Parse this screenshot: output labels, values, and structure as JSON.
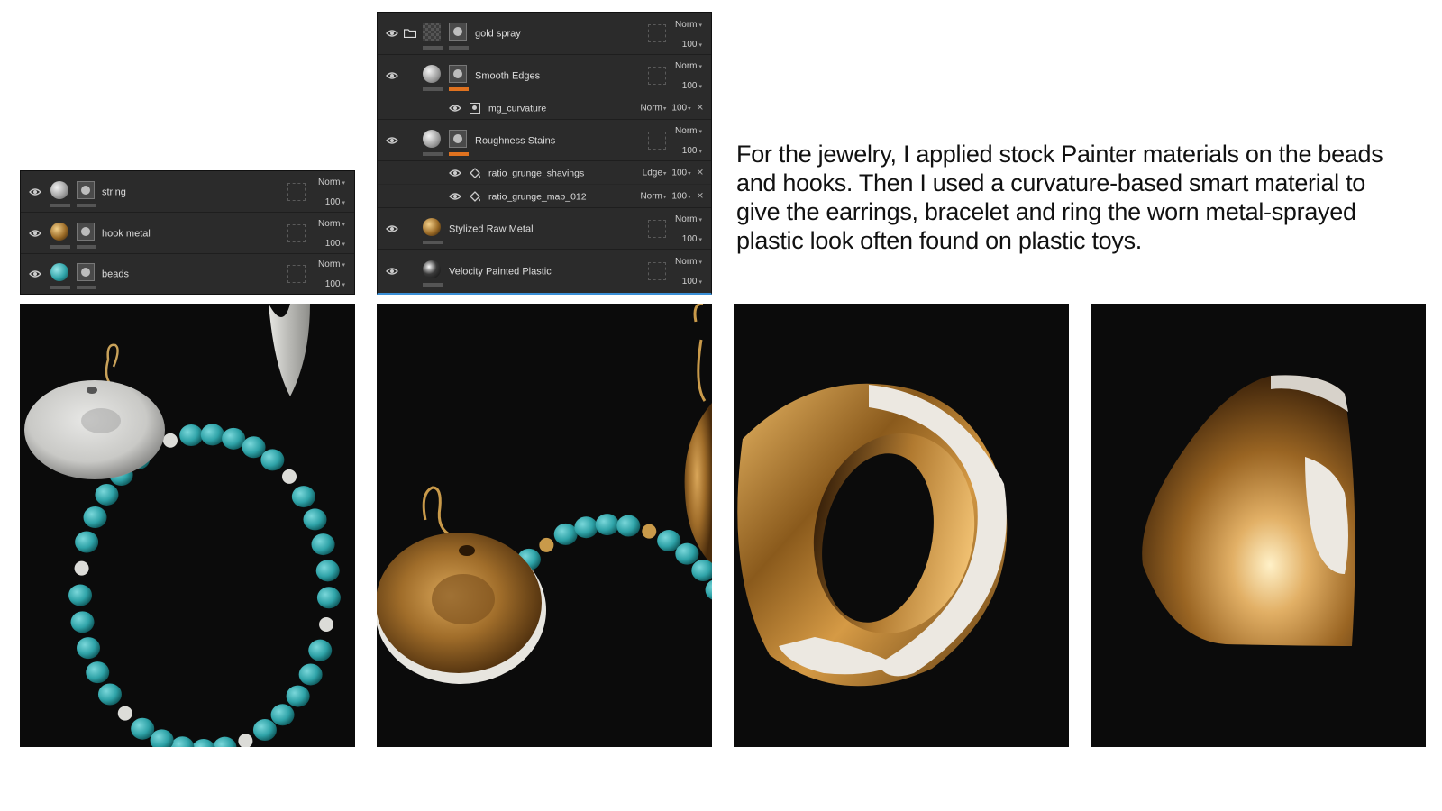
{
  "panel_left": {
    "layers": [
      {
        "name": "string",
        "blend": "Norm",
        "opacity": "100"
      },
      {
        "name": "hook metal",
        "blend": "Norm",
        "opacity": "100"
      },
      {
        "name": "beads",
        "blend": "Norm",
        "opacity": "100"
      }
    ]
  },
  "panel_mid": {
    "layers": [
      {
        "name": "gold spray",
        "blend": "Norm",
        "opacity": "100"
      },
      {
        "name": "Smooth Edges",
        "blend": "Norm",
        "opacity": "100"
      },
      {
        "name": "mg_curvature",
        "blend": "Norm",
        "opacity": "100"
      },
      {
        "name": "Roughness Stains",
        "blend": "Norm",
        "opacity": "100"
      },
      {
        "name": "ratio_grunge_shavings",
        "blend": "Ldge",
        "opacity": "100"
      },
      {
        "name": "ratio_grunge_map_012",
        "blend": "Norm",
        "opacity": "100"
      },
      {
        "name": "Stylized Raw Metal",
        "blend": "Norm",
        "opacity": "100"
      },
      {
        "name": "Velocity Painted Plastic",
        "blend": "Norm",
        "opacity": "100"
      }
    ]
  },
  "caption": "For the jewelry, I applied stock Painter materials on the beads and hooks. Then I used a curvature-based smart material to give the earrings, bracelet and ring the worn metal-sprayed plastic look often found on plastic toys.",
  "colors": {
    "panel_bg": "#2b2b2b",
    "accent_orange": "#e0721f",
    "bead_teal": "#2fa3a8",
    "gold": "#b07a2c"
  },
  "icons": [
    "eye-icon",
    "folder-icon",
    "mask-icon",
    "fill-bucket-icon",
    "chevron-down-icon",
    "close-icon"
  ]
}
